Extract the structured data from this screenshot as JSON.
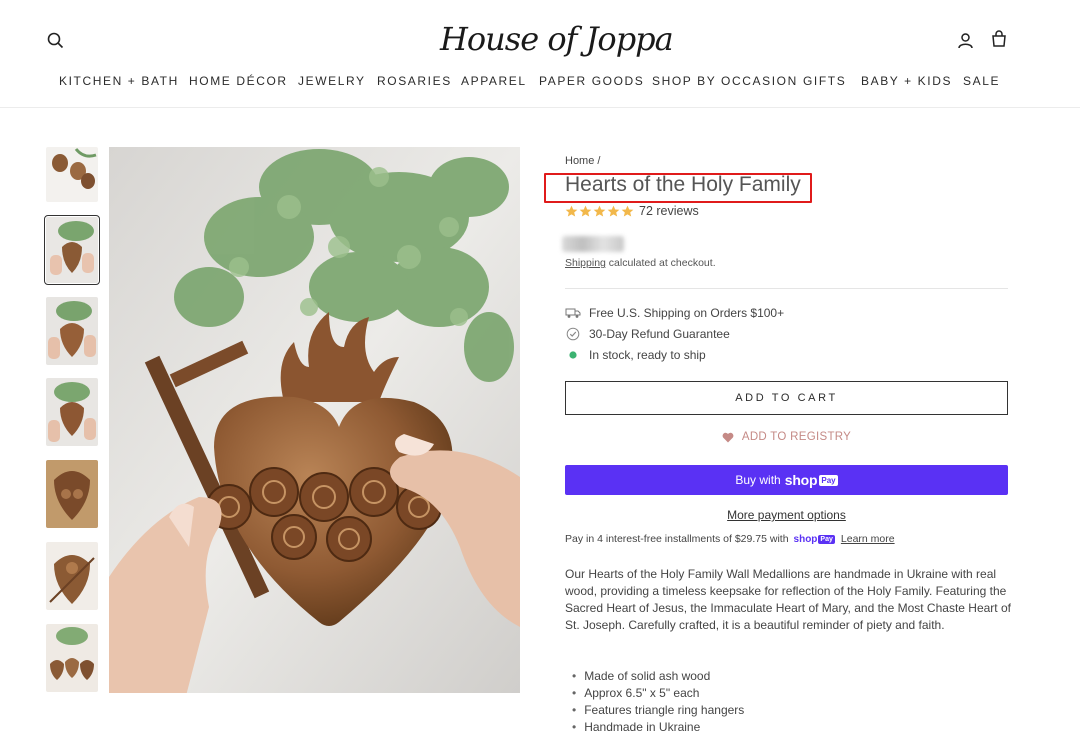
{
  "brand": {
    "logo_text": "House of Joppa"
  },
  "nav": [
    {
      "label": "KITCHEN + BATH"
    },
    {
      "label": "HOME DÉCOR"
    },
    {
      "label": "JEWELRY"
    },
    {
      "label": "ROSARIES"
    },
    {
      "label": "APPAREL"
    },
    {
      "label": "PAPER GOODS"
    },
    {
      "label": "SHOP BY OCCASION"
    },
    {
      "label": "GIFTS"
    },
    {
      "label": "BABY + KIDS"
    },
    {
      "label": "SALE"
    }
  ],
  "icons": {
    "search": "search-icon",
    "account": "user-icon",
    "cart": "cart-icon"
  },
  "breadcrumb": {
    "home": "Home",
    "separator": "/"
  },
  "product": {
    "title": "Hearts of the Holy Family",
    "rating": 5,
    "reviews": "72 reviews",
    "shipping_prefix": "Shipping",
    "shipping_suffix": " calculated at checkout.",
    "features": [
      {
        "icon": "truck-icon",
        "text": "Free U.S. Shipping on Orders $100+"
      },
      {
        "icon": "check-badge-icon",
        "text": "30-Day Refund Guarantee"
      },
      {
        "icon": "green-dot-icon",
        "text": "In stock, ready to ship"
      }
    ],
    "add_to_cart": "ADD TO CART",
    "registry": "ADD TO REGISTRY",
    "buy_with": "Buy with",
    "shop_word": "shop",
    "pay_badge": "Pay",
    "more_payment": "More payment options",
    "installments": "Pay in 4 interest-free installments of $29.75 with",
    "learn_more": "Learn more",
    "description": "Our Hearts of the Holy Family Wall Medallions are handmade in Ukraine with real wood, providing a timeless keepsake for reflection of the Holy Family. Featuring the Sacred Heart of Jesus, the Immaculate Heart of Mary, and the Most Chaste Heart of St. Joseph. Carefully crafted, it is a beautiful reminder of piety and faith.",
    "bullets": [
      "Made of solid ash wood",
      "Approx 6.5\" x 5\" each",
      "Features triangle ring hangers",
      "Handmade in Ukraine"
    ]
  },
  "gallery": {
    "thumb_count": 7,
    "active_index": 1
  },
  "colors": {
    "shop_pay": "#5a31f4",
    "star": "#f2b84b",
    "registry": "#c58a86",
    "highlight_box": "#e01b1b",
    "in_stock": "#3cb371"
  }
}
